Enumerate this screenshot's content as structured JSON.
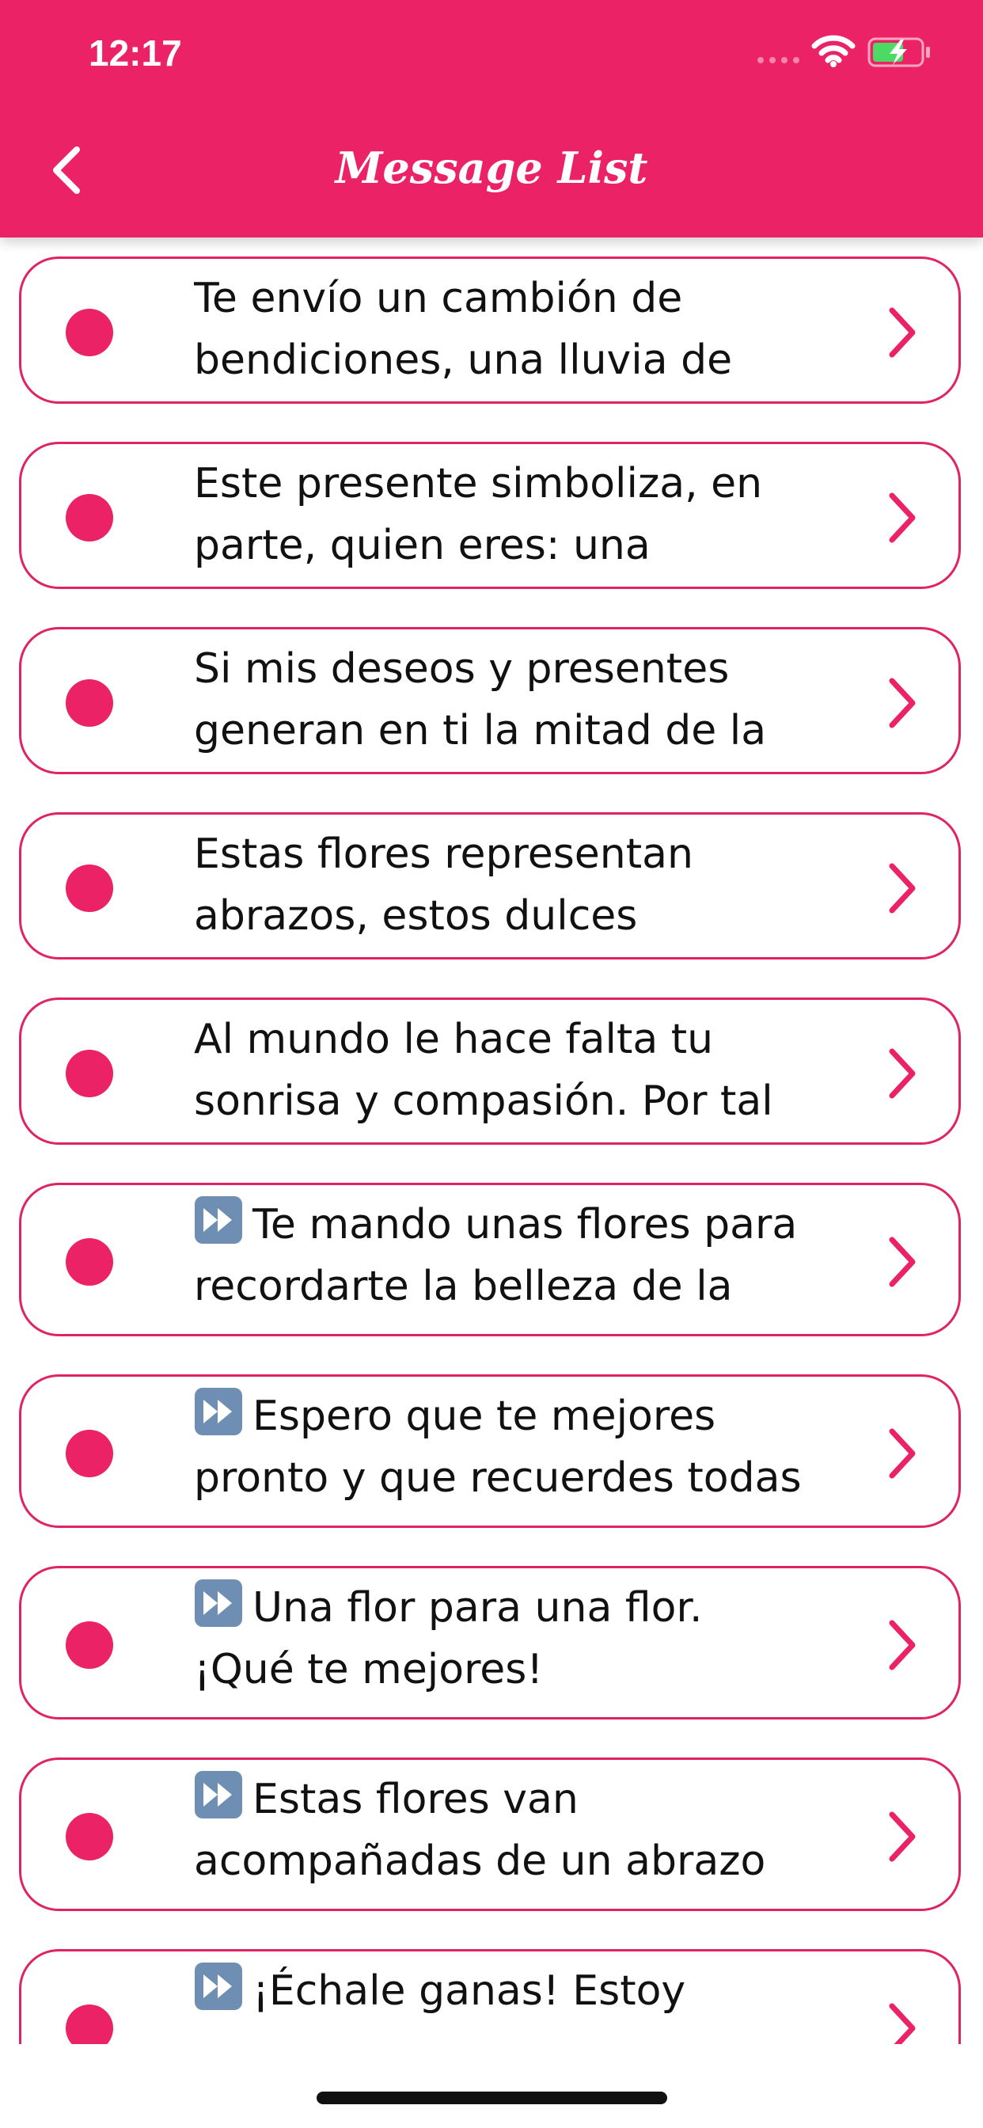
{
  "status_bar": {
    "time": "12:17"
  },
  "header": {
    "title": "Message List"
  },
  "colors": {
    "primary": "#ec2266",
    "border": "#e02463",
    "text": "#111111"
  },
  "messages": [
    {
      "line1": "Te envío un cambión de",
      "line2": "bendiciones, una lluvia de",
      "has_play_icon": false
    },
    {
      "line1": "Este presente simboliza, en",
      "line2": "parte, quien eres: una",
      "has_play_icon": false
    },
    {
      "line1": "Si mis deseos y presentes",
      "line2": "generan en ti la mitad de la",
      "has_play_icon": false
    },
    {
      "line1": "Estas flores representan",
      "line2": "abrazos, estos dulces",
      "has_play_icon": false
    },
    {
      "line1": "Al mundo le hace falta tu",
      "line2": "sonrisa y compasión. Por tal",
      "has_play_icon": false
    },
    {
      "line1": "Te mando unas flores para",
      "line2": "recordarte la belleza de la",
      "has_play_icon": true
    },
    {
      "line1": "Espero que te mejores",
      "line2": "pronto y que recuerdes todas",
      "has_play_icon": true
    },
    {
      "line1": "Una flor para una flor.",
      "line2": "¡Qué te mejores!",
      "has_play_icon": true
    },
    {
      "line1": "Estas flores van",
      "line2": "acompañadas de un abrazo",
      "has_play_icon": true
    },
    {
      "line1": "¡Échale ganas! Estoy",
      "line2": "",
      "has_play_icon": true
    }
  ],
  "icons": {
    "back": "chevron-left-icon",
    "row_marker": "dot-icon",
    "row_action": "chevron-right-icon",
    "play": "fast-forward-icon"
  }
}
